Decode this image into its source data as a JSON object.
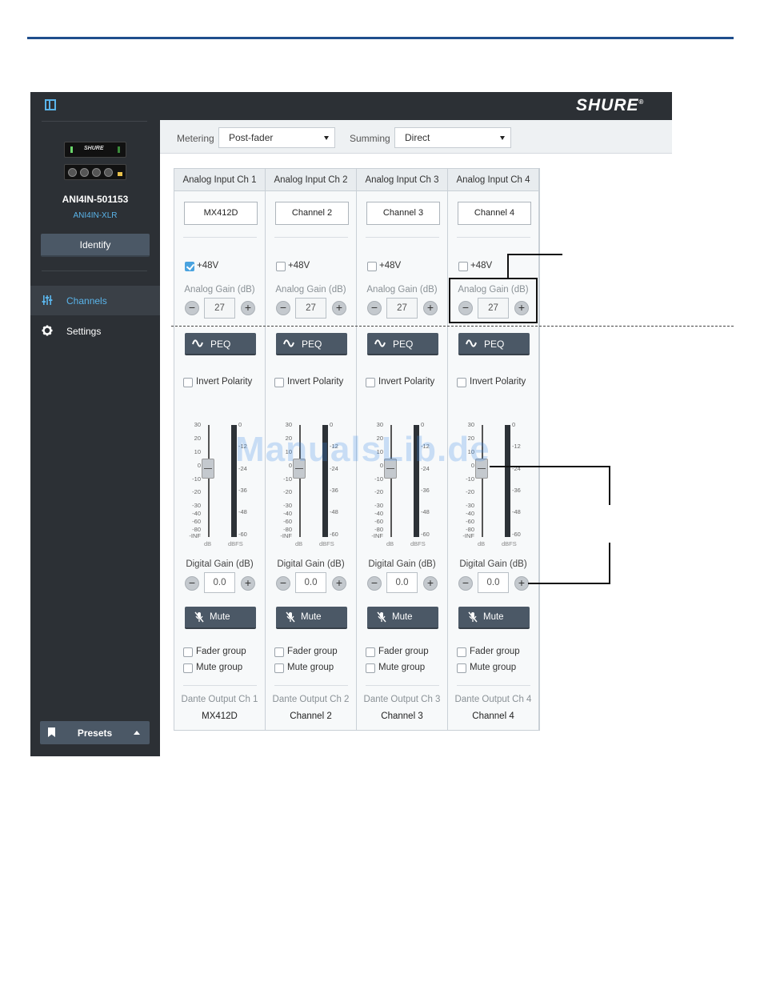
{
  "app": {
    "brand": "SHURE",
    "brand_mark": "®"
  },
  "device": {
    "name": "ANI4IN-501153",
    "model": "ANI4IN-XLR",
    "faceplate_label": "SHURE",
    "identify_label": "Identify"
  },
  "nav": [
    {
      "label": "Channels",
      "icon": "sliders-icon",
      "active": true
    },
    {
      "label": "Settings",
      "icon": "gear-icon",
      "active": false
    }
  ],
  "presets_label": "Presets",
  "toolbar": {
    "metering_label": "Metering",
    "metering_value": "Post-fader",
    "summing_label": "Summing",
    "summing_value": "Direct"
  },
  "common": {
    "phantom_label": "+48V",
    "analog_gain_label": "Analog Gain (dB)",
    "peq_label": "PEQ",
    "invert_label": "Invert Polarity",
    "digital_gain_label": "Digital Gain (dB)",
    "mute_label": "Mute",
    "fader_group_label": "Fader group",
    "mute_group_label": "Mute group",
    "minus": "−",
    "plus": "+",
    "db_unit": "dB",
    "dbfs_unit": "dBFS"
  },
  "fader_scale": [
    "30",
    "20",
    "10",
    "0",
    "-10",
    "-20",
    "-30",
    "-40",
    "-60",
    "-80",
    "-INF"
  ],
  "meter_scale": [
    "0",
    "-12",
    "-24",
    "-36",
    "-48",
    "-60"
  ],
  "channels": [
    {
      "header": "Analog Input Ch 1",
      "name": "MX412D",
      "phantom": true,
      "analog_gain": "27",
      "digital_gain": "0.0",
      "output_label": "Dante Output Ch 1",
      "output_name": "MX412D"
    },
    {
      "header": "Analog Input Ch 2",
      "name": "Channel 2",
      "phantom": false,
      "analog_gain": "27",
      "digital_gain": "0.0",
      "output_label": "Dante Output Ch 2",
      "output_name": "Channel 2"
    },
    {
      "header": "Analog Input Ch 3",
      "name": "Channel 3",
      "phantom": false,
      "analog_gain": "27",
      "digital_gain": "0.0",
      "output_label": "Dante Output Ch 3",
      "output_name": "Channel 3"
    },
    {
      "header": "Analog Input Ch 4",
      "name": "Channel 4",
      "phantom": false,
      "analog_gain": "27",
      "digital_gain": "0.0",
      "output_label": "Dante Output Ch 4",
      "output_name": "Channel 4"
    }
  ],
  "watermark": "ManualsLib.de",
  "colors": {
    "accent": "#5ab4ea",
    "sidebar": "#2c3035",
    "button": "#4b5866",
    "rule": "#1f4e8c"
  }
}
